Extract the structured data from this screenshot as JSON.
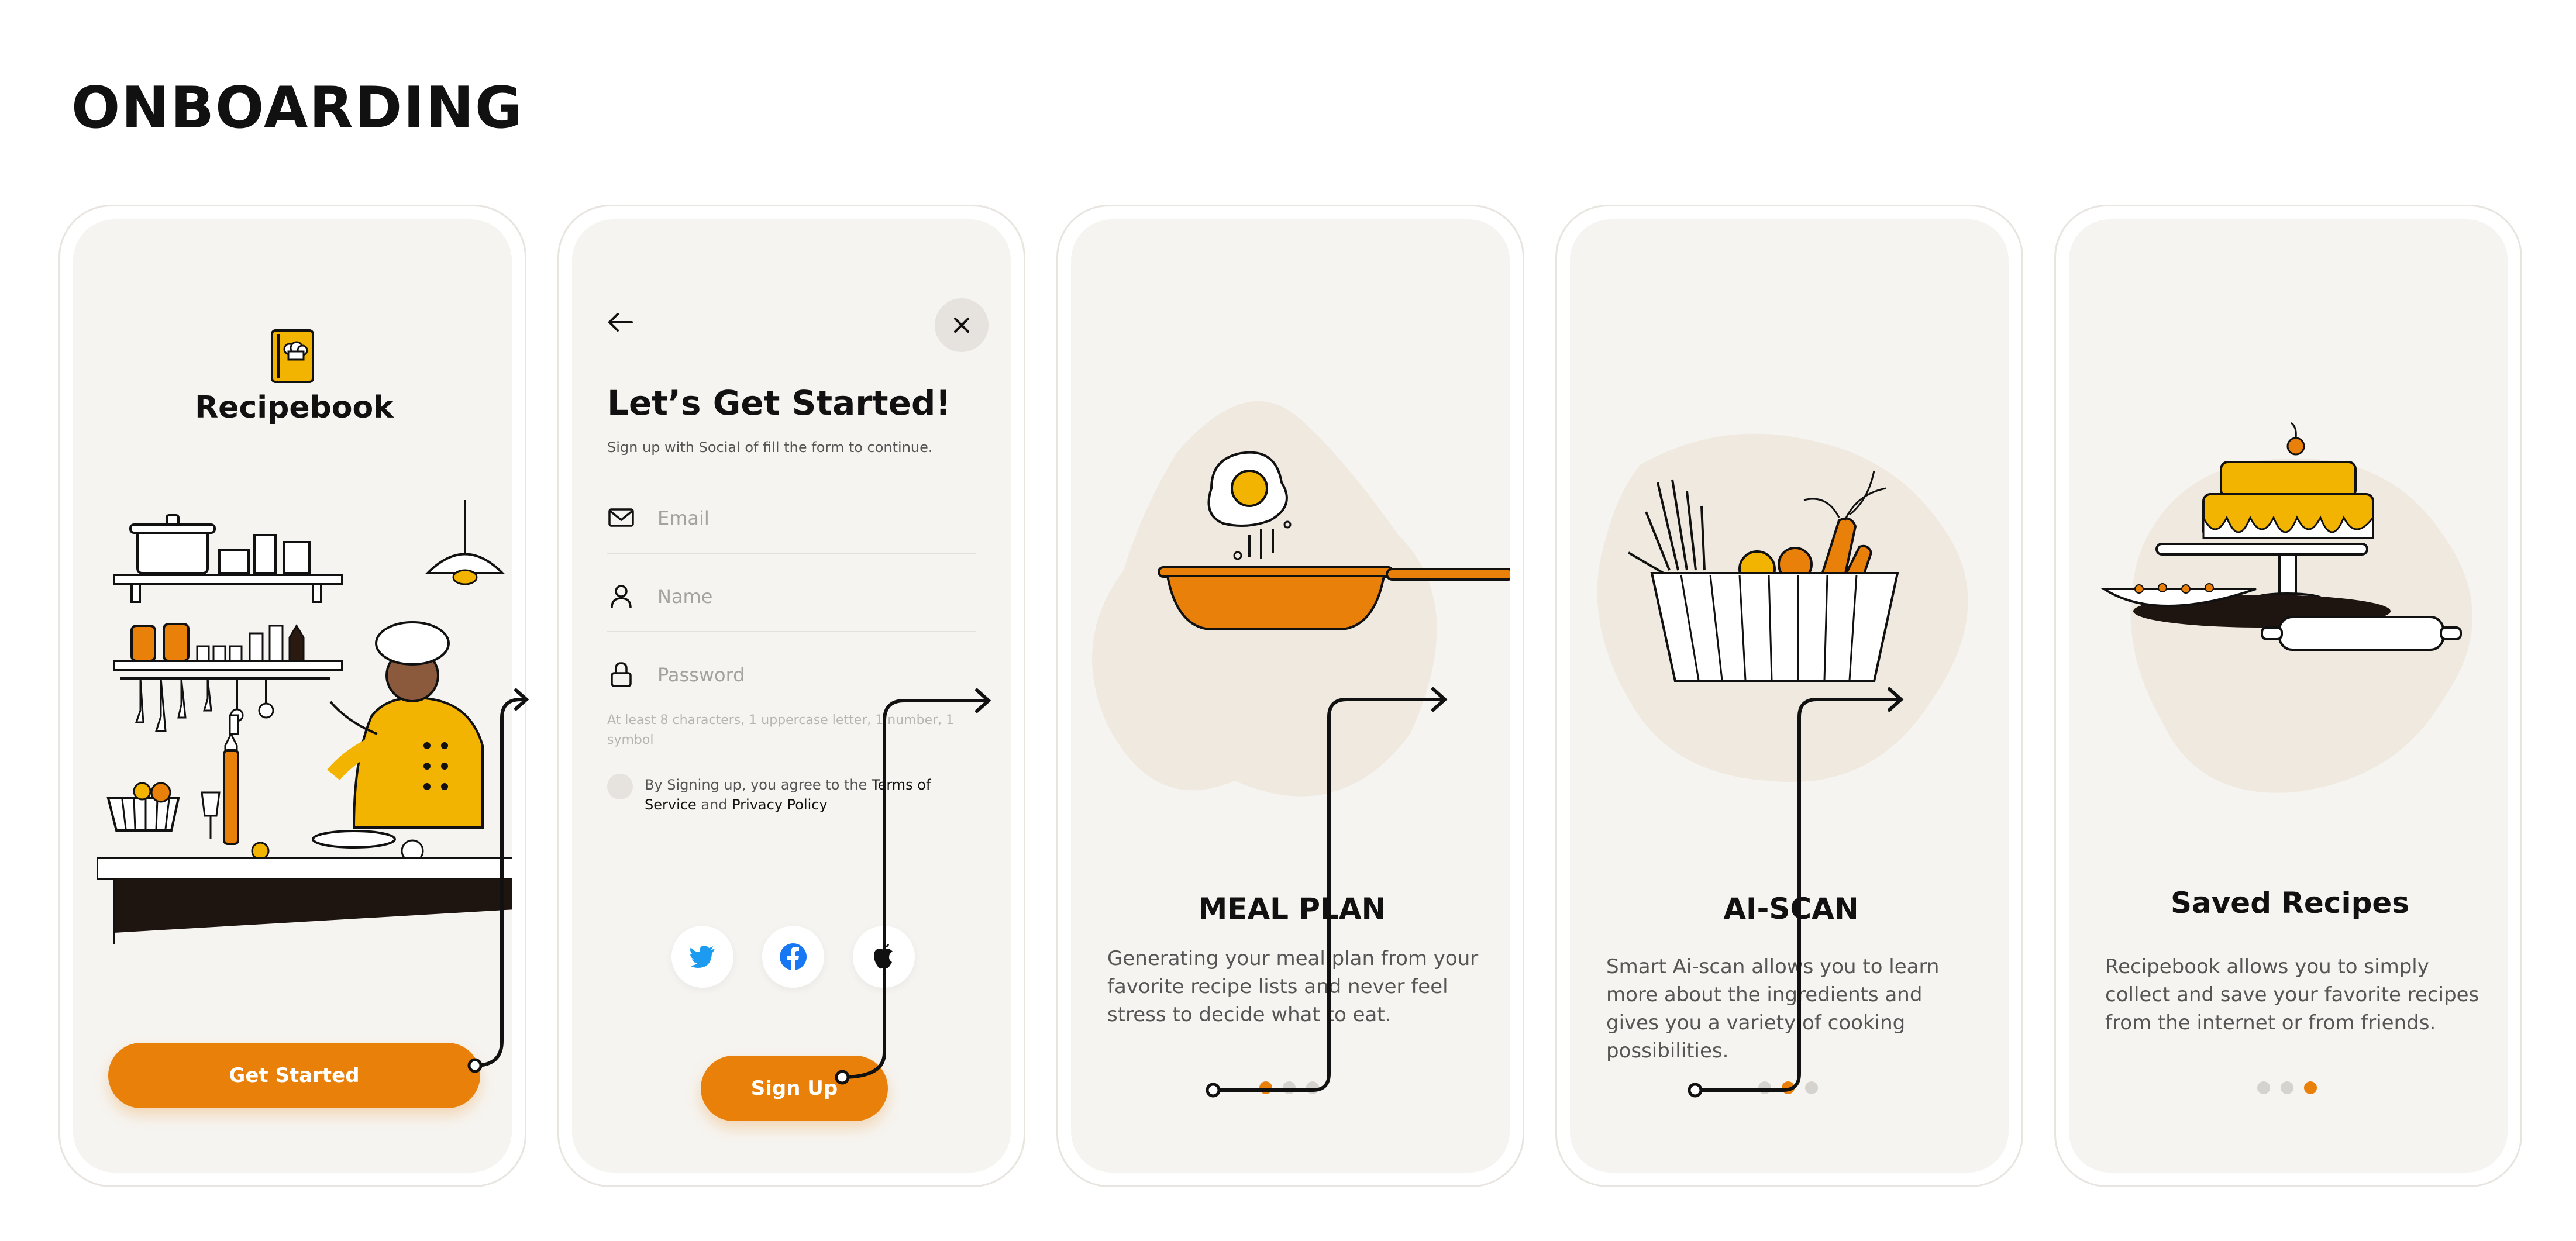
{
  "page": {
    "title": "ONBOARDING"
  },
  "colors": {
    "accent": "#e8800a",
    "yellow": "#f2b400",
    "screen_bg": "#f6f4f0",
    "ink": "#111111"
  },
  "screen1": {
    "brand": "Recipebook",
    "cta_label": "Get Started",
    "illustration": "chef-kitchen-illustration"
  },
  "screen2": {
    "back_icon": "arrow-left-icon",
    "close_icon": "close-icon",
    "title": "Let’s Get Started!",
    "subtitle": "Sign up with Social of fill the form to continue.",
    "email_placeholder": "Email",
    "name_placeholder": "Name",
    "password_placeholder": "Password",
    "password_hint": "At least 8 characters, 1 uppercase letter, 1 number, 1 symbol",
    "terms_prefix": "By Signing up, you agree to the ",
    "terms_link": "Terms of Service",
    "terms_and": " and ",
    "privacy_link": "Privacy Policy",
    "social": [
      "twitter-icon",
      "facebook-icon",
      "apple-icon"
    ],
    "signup_label": "Sign Up"
  },
  "screen3": {
    "title": "MEAL PLAN",
    "text": "Generating your meal plan from your favorite recipe lists and never feel stress to decide what to eat.",
    "active_dot": 0
  },
  "screen4": {
    "title": "AI-SCAN",
    "text": "Smart Ai-scan allows you to learn more about the ingredients and gives you a variety of cooking possibilities.",
    "active_dot": 1
  },
  "screen5": {
    "title": "Saved Recipes",
    "text": "Recipebook allows you to simply collect and save your favorite recipes from the internet or from friends.",
    "active_dot": 2
  }
}
